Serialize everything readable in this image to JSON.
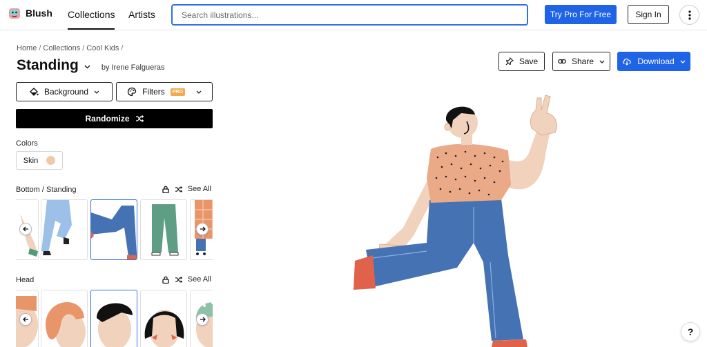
{
  "brand": {
    "name": "Blush",
    "logo_icon": "blush-logo-icon"
  },
  "nav": {
    "tabs": [
      {
        "label": "Collections",
        "active": true
      },
      {
        "label": "Artists",
        "active": false
      }
    ]
  },
  "search": {
    "placeholder": "Search illustrations...",
    "value": ""
  },
  "header_actions": {
    "try_pro": "Try Pro For Free",
    "sign_in": "Sign In",
    "more_icon": "vertical-dots-icon"
  },
  "breadcrumb": {
    "items": [
      "Home",
      "Collections",
      "Cool Kids"
    ],
    "separator": "/"
  },
  "title": {
    "text": "Standing",
    "author": "by Irene Falgueras"
  },
  "controls": {
    "background": "Background",
    "filters": "Filters",
    "pro_badge": "PRO",
    "randomize": "Randomize"
  },
  "colors": {
    "label": "Colors",
    "skin_label": "Skin",
    "skin_color": "#f0c9a8"
  },
  "sections": [
    {
      "label": "Bottom / Standing",
      "see_all": "See All"
    },
    {
      "label": "Head",
      "see_all": "See All"
    }
  ],
  "actions": {
    "save": "Save",
    "share": "Share",
    "download": "Download"
  },
  "help": {
    "label": "?"
  },
  "palette": {
    "accent": "#1f63e6",
    "jeans": "#4572b3",
    "skin": "#f0d2bd",
    "shirt": "#eaa987",
    "shoe": "#e1624a"
  }
}
